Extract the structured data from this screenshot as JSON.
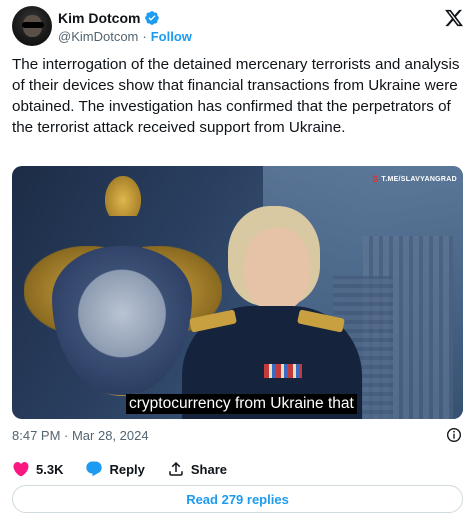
{
  "author": {
    "display_name": "Kim Dotcom",
    "handle": "@KimDotcom",
    "separator": "·",
    "follow_label": "Follow",
    "verified_color": "#1d9bf0"
  },
  "tweet": {
    "text": "The interrogation of the detained mercenary terrorists and analysis of their devices show that financial transactions from Ukraine were obtained. The investigation has confirmed that the perpetrators of the terrorist attack received support from Ukraine."
  },
  "media": {
    "watermark_symbol": "S",
    "watermark_text": "T.ME/SLAVYANGRAD",
    "caption": "cryptocurrency from Ukraine that"
  },
  "meta": {
    "timestamp": "8:47 PM · Mar 28, 2024"
  },
  "actions": {
    "like_count": "5.3K",
    "reply_label": "Reply",
    "share_label": "Share",
    "like_color": "#f91880",
    "reply_color": "#1d9bf0"
  },
  "footer": {
    "read_replies_label": "Read 279 replies"
  },
  "icons": [
    "x-logo-icon",
    "verified-badge-icon",
    "info-icon",
    "heart-icon",
    "reply-bubble-icon",
    "share-icon"
  ]
}
